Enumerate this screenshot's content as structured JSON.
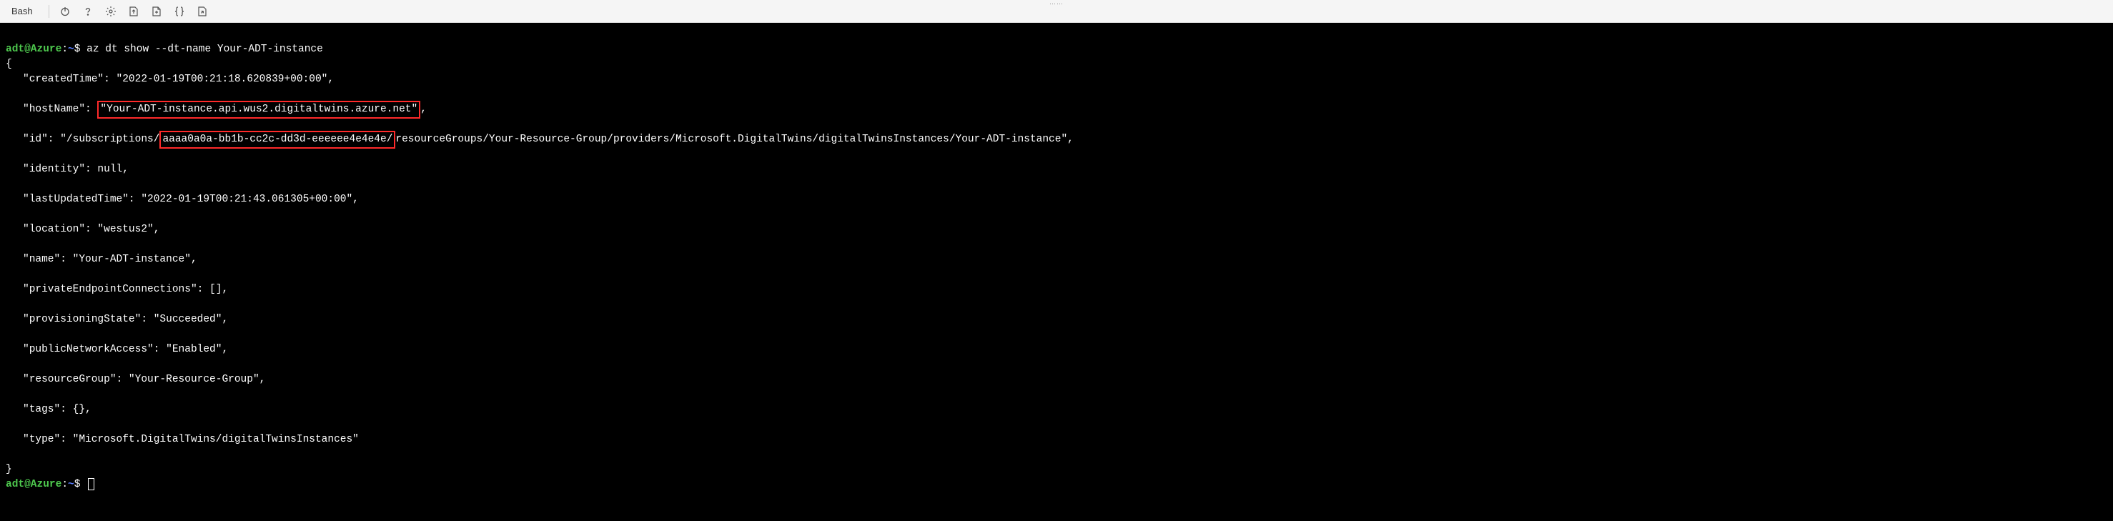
{
  "toolbar": {
    "shell_label": "Bash"
  },
  "prompt": {
    "user_host": "adt@Azure",
    "colon": ":",
    "path": "~",
    "dollar": "$"
  },
  "command": "az dt show --dt-name Your-ADT-instance",
  "json_output": {
    "open_brace": "{",
    "createdTime_key": "\"createdTime\": ",
    "createdTime_val": "\"2022-01-19T00:21:18.620839+00:00\",",
    "hostName_key": "\"hostName\": ",
    "hostName_quote_open": "\"",
    "hostName_val": "Your-ADT-instance.api.wus2.digitaltwins.azure.net",
    "hostName_quote_close": "\"",
    "hostName_comma": ",",
    "id_key": "\"id\": ",
    "id_prefix": "\"/subscriptions/",
    "id_sub": "aaaa0a0a-bb1b-cc2c-dd3d-eeeeee4e4e4e/",
    "id_suffix": "resourceGroups/Your-Resource-Group/providers/Microsoft.DigitalTwins/digitalTwinsInstances/Your-ADT-instance\",",
    "identity": "\"identity\": null,",
    "lastUpdatedTime": "\"lastUpdatedTime\": \"2022-01-19T00:21:43.061305+00:00\",",
    "location": "\"location\": \"westus2\",",
    "name": "\"name\": \"Your-ADT-instance\",",
    "privateEndpoint": "\"privateEndpointConnections\": [],",
    "provisioningState": "\"provisioningState\": \"Succeeded\",",
    "publicNetworkAccess": "\"publicNetworkAccess\": \"Enabled\",",
    "resourceGroup": "\"resourceGroup\": \"Your-Resource-Group\",",
    "tags": "\"tags\": {},",
    "type": "\"type\": \"Microsoft.DigitalTwins/digitalTwinsInstances\"",
    "close_brace": "}"
  }
}
